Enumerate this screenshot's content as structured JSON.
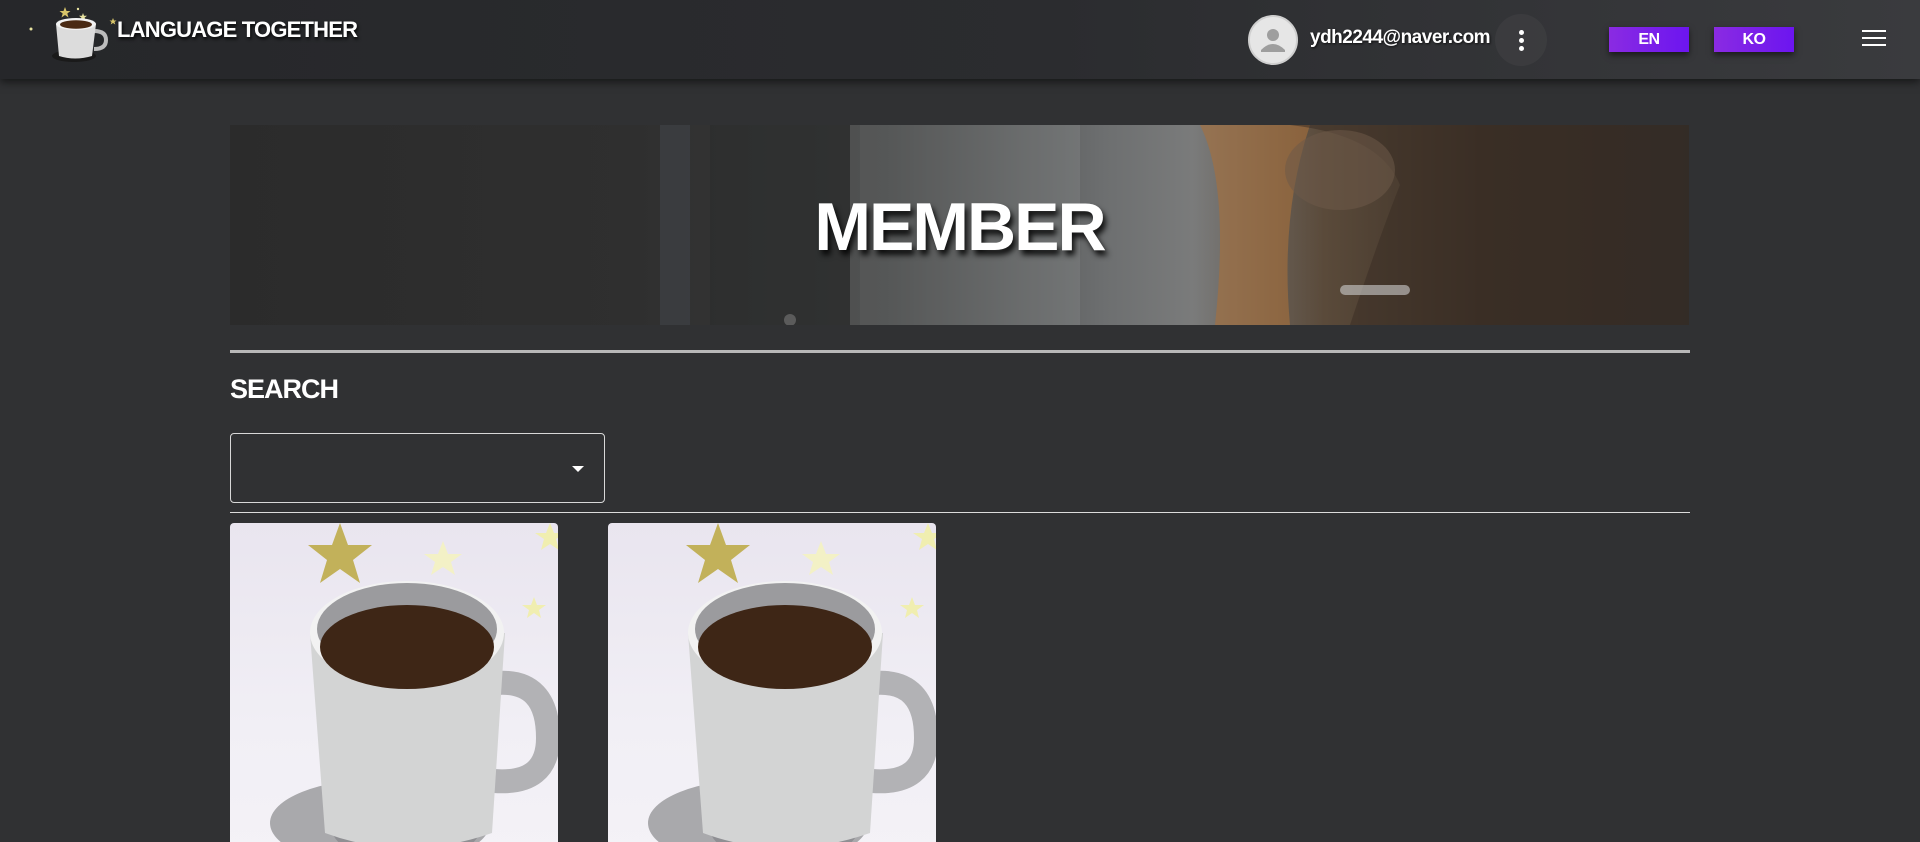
{
  "header": {
    "brand": "LANGUAGE TOGETHER",
    "user_email": "ydh2244@naver.com",
    "lang_en": "EN",
    "lang_ko": "KO"
  },
  "hero": {
    "title": "MEMBER"
  },
  "search": {
    "heading": "SEARCH",
    "select_value": ""
  },
  "members": [
    {
      "image": "coffee-cup"
    },
    {
      "image": "coffee-cup"
    }
  ],
  "colors": {
    "background": "#303133",
    "accent": "#8a2be2",
    "accent_2": "#6c15f0"
  }
}
